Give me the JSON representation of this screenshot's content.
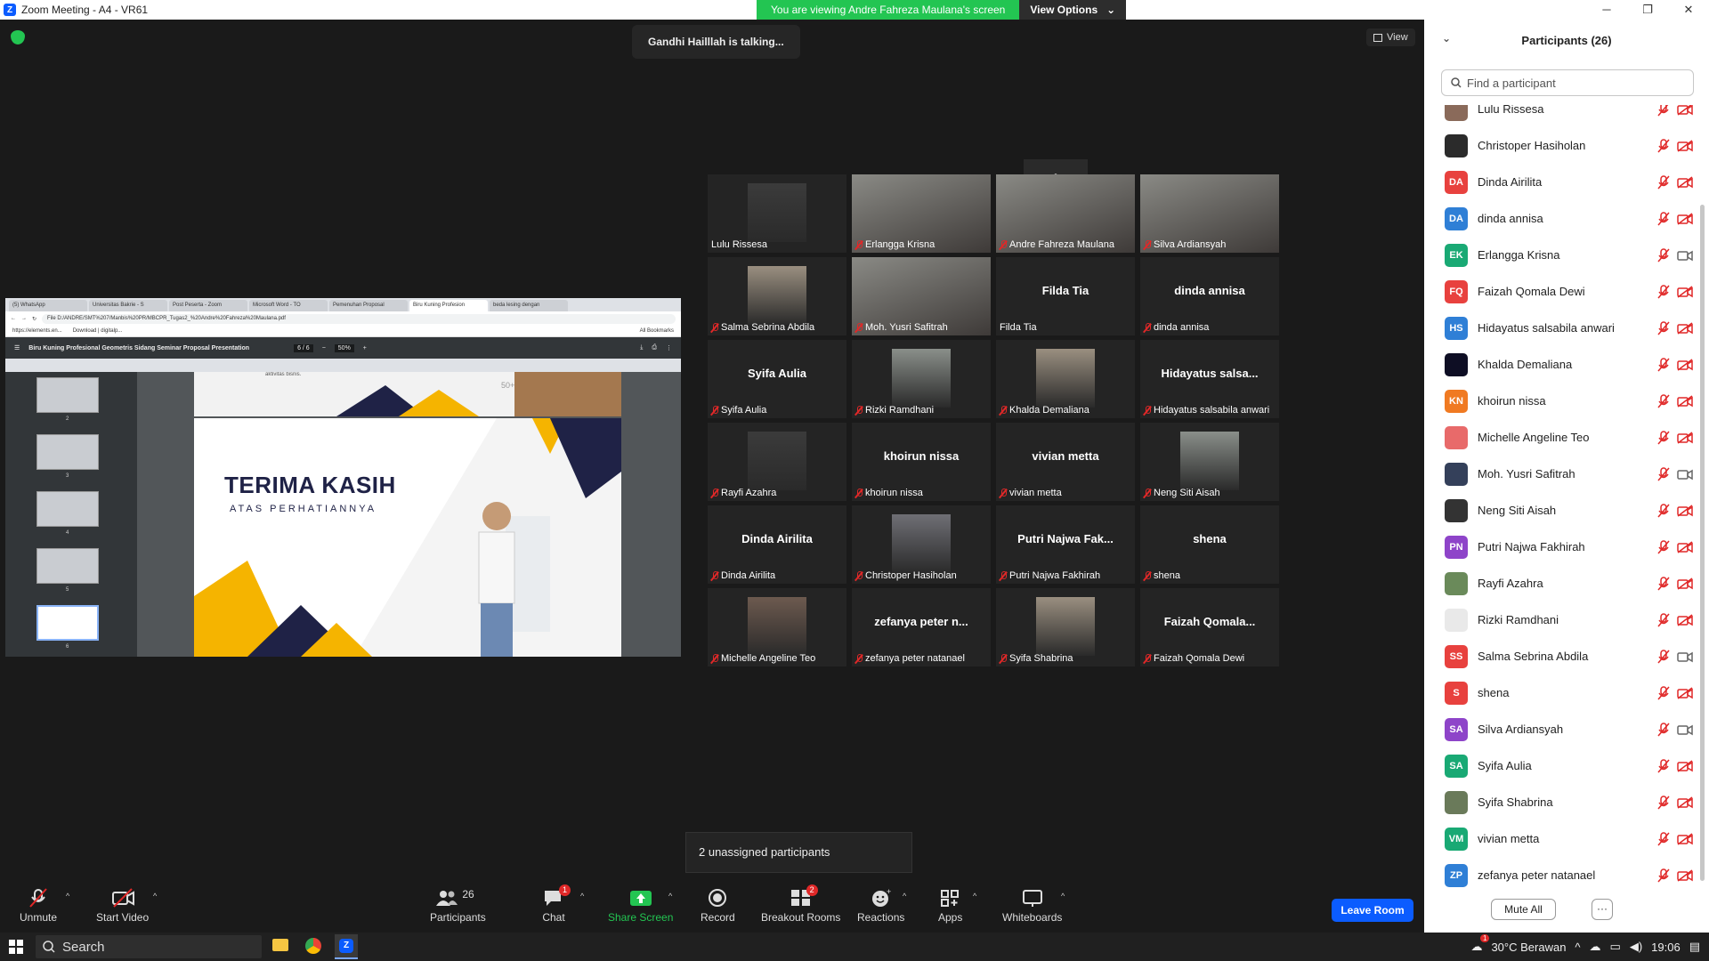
{
  "window": {
    "title": "Zoom Meeting - A4 - VR61"
  },
  "share_banner": {
    "text": "You are viewing Andre Fahreza Maulana's screen",
    "view_options": "View Options"
  },
  "talking_indicator": "Gandhi Hailllah is talking...",
  "view_button": "View",
  "shared_screen": {
    "tabs": [
      "(5) WhatsApp",
      "Universitas Bakrie - S",
      "Post Peserta - Zoom",
      "Microsoft Word - TO",
      "Pemenuhan Proposal",
      "Biru Kuning Profesion",
      "beda lesing dengan"
    ],
    "url": "File   D:/ANDRE/SMT%207/Manbis%20PR/MBCPR_Tugas2_%20Andre%20Fahreza%20Maulana.pdf",
    "bookmarks": [
      "https://elements.en...",
      "Download | digitalp...",
      "All Bookmarks"
    ],
    "pdf_title": "Biru Kuning Profesional Geometris Sidang Seminar Proposal Presentation",
    "page_indicator": "6 / 6",
    "zoom": "50%",
    "thumb_numbers": [
      "2",
      "3",
      "4",
      "5",
      "6"
    ],
    "prev_slide_text": "aktivitas bisnis.",
    "prev_slide_badge": "50+",
    "slide_title": "TERIMA KASIH",
    "slide_subtitle": "ATAS PERHATIANNYA"
  },
  "gallery": [
    {
      "name": "Lulu Rissesa",
      "big": "",
      "type": "photo",
      "muted": false
    },
    {
      "name": "Erlangga Krisna",
      "big": "",
      "type": "full",
      "muted": true
    },
    {
      "name": "Andre Fahreza Maulana",
      "big": "",
      "type": "full",
      "muted": true
    },
    {
      "name": "Silva Ardiansyah",
      "big": "",
      "type": "full",
      "muted": true
    },
    {
      "name": "Salma Sebrina Abdila",
      "big": "",
      "type": "photo",
      "muted": true
    },
    {
      "name": "Moh. Yusri Safitrah",
      "big": "",
      "type": "full",
      "muted": true
    },
    {
      "name": "Filda Tia",
      "big": "Filda Tia",
      "type": "text",
      "muted": false
    },
    {
      "name": "dinda annisa",
      "big": "dinda annisa",
      "type": "text",
      "muted": true
    },
    {
      "name": "Syifa Aulia",
      "big": "Syifa Aulia",
      "type": "text",
      "muted": true
    },
    {
      "name": "Rizki Ramdhani",
      "big": "",
      "type": "photo",
      "muted": true
    },
    {
      "name": "Khalda Demaliana",
      "big": "",
      "type": "photo",
      "muted": true
    },
    {
      "name": "Hidayatus salsabila anwari",
      "big": "Hidayatus  salsa...",
      "type": "text",
      "muted": true
    },
    {
      "name": "Rayfi Azahra",
      "big": "",
      "type": "photo",
      "muted": true
    },
    {
      "name": "khoirun nissa",
      "big": "khoirun nissa",
      "type": "text",
      "muted": true
    },
    {
      "name": "vivian metta",
      "big": "vivian metta",
      "type": "text",
      "muted": true
    },
    {
      "name": "Neng Siti Aisah",
      "big": "",
      "type": "photo",
      "muted": true
    },
    {
      "name": "Dinda Airilita",
      "big": "Dinda Airilita",
      "type": "text",
      "muted": true
    },
    {
      "name": "Christoper Hasiholan",
      "big": "",
      "type": "photo",
      "muted": true
    },
    {
      "name": "Putri Najwa Fakhirah",
      "big": "Putri  Najwa  Fak...",
      "type": "text",
      "muted": true
    },
    {
      "name": "shena",
      "big": "shena",
      "type": "text",
      "muted": true
    },
    {
      "name": "Michelle Angeline Teo",
      "big": "",
      "type": "photo",
      "muted": true
    },
    {
      "name": "zefanya peter natanael",
      "big": "zefanya  peter  n...",
      "type": "text",
      "muted": true
    },
    {
      "name": "Syifa Shabrina",
      "big": "",
      "type": "photo",
      "muted": true
    },
    {
      "name": "Faizah Qomala Dewi",
      "big": "Faizah  Qomala...",
      "type": "text",
      "muted": true
    }
  ],
  "unassigned": "2 unassigned participants",
  "toolbar": {
    "unmute": "Unmute",
    "start_video": "Start Video",
    "participants": "Participants",
    "participants_count": "26",
    "chat": "Chat",
    "chat_badge": "1",
    "share_screen": "Share Screen",
    "record": "Record",
    "breakout_rooms": "Breakout Rooms",
    "breakout_badge": "2",
    "reactions": "Reactions",
    "apps": "Apps",
    "whiteboards": "Whiteboards",
    "leave": "Leave Room"
  },
  "participants_panel": {
    "title": "Participants (26)",
    "search_placeholder": "Find a participant",
    "mute_all": "Mute All",
    "more": "···",
    "list": [
      {
        "name": "Lulu Rissesa",
        "initials": "",
        "color": "#8a6a5a",
        "cam_on": false
      },
      {
        "name": "Christoper Hasiholan",
        "initials": "",
        "color": "#2b2b2b",
        "cam_on": false
      },
      {
        "name": "Dinda Airilita",
        "initials": "DA",
        "color": "#e8413e",
        "cam_on": false
      },
      {
        "name": "dinda annisa",
        "initials": "DA",
        "color": "#2f7fd6",
        "cam_on": false
      },
      {
        "name": "Erlangga Krisna",
        "initials": "EK",
        "color": "#19a974",
        "cam_on": true
      },
      {
        "name": "Faizah Qomala Dewi",
        "initials": "FQ",
        "color": "#e8413e",
        "cam_on": false
      },
      {
        "name": "Hidayatus salsabila anwari",
        "initials": "HS",
        "color": "#2f7fd6",
        "cam_on": false
      },
      {
        "name": "Khalda Demaliana",
        "initials": "",
        "color": "#0e0e24",
        "cam_on": false
      },
      {
        "name": "khoirun nissa",
        "initials": "KN",
        "color": "#f07a22",
        "cam_on": false
      },
      {
        "name": "Michelle Angeline Teo",
        "initials": "",
        "color": "#e86a6a",
        "cam_on": false
      },
      {
        "name": "Moh. Yusri Safitrah",
        "initials": "",
        "color": "#34405a",
        "cam_on": true
      },
      {
        "name": "Neng Siti Aisah",
        "initials": "",
        "color": "#333333",
        "cam_on": false
      },
      {
        "name": "Putri Najwa Fakhirah",
        "initials": "PN",
        "color": "#8e44c9",
        "cam_on": false
      },
      {
        "name": "Rayfi Azahra",
        "initials": "",
        "color": "#6a8a5a",
        "cam_on": false
      },
      {
        "name": "Rizki Ramdhani",
        "initials": "",
        "color": "#e9e9e9",
        "cam_on": false
      },
      {
        "name": "Salma Sebrina Abdila",
        "initials": "SS",
        "color": "#e8413e",
        "cam_on": true
      },
      {
        "name": "shena",
        "initials": "S",
        "color": "#e8413e",
        "cam_on": false
      },
      {
        "name": "Silva Ardiansyah",
        "initials": "SA",
        "color": "#8e44c9",
        "cam_on": true
      },
      {
        "name": "Syifa Aulia",
        "initials": "SA",
        "color": "#19a974",
        "cam_on": false
      },
      {
        "name": "Syifa Shabrina",
        "initials": "",
        "color": "#6a7a5a",
        "cam_on": false
      },
      {
        "name": "vivian metta",
        "initials": "VM",
        "color": "#19a974",
        "cam_on": false
      },
      {
        "name": "zefanya peter natanael",
        "initials": "ZP",
        "color": "#2f7fd6",
        "cam_on": false
      }
    ]
  },
  "taskbar": {
    "search": "Search",
    "weather": "30°C  Berawan",
    "weather_badge": "1",
    "time": "19:06"
  }
}
